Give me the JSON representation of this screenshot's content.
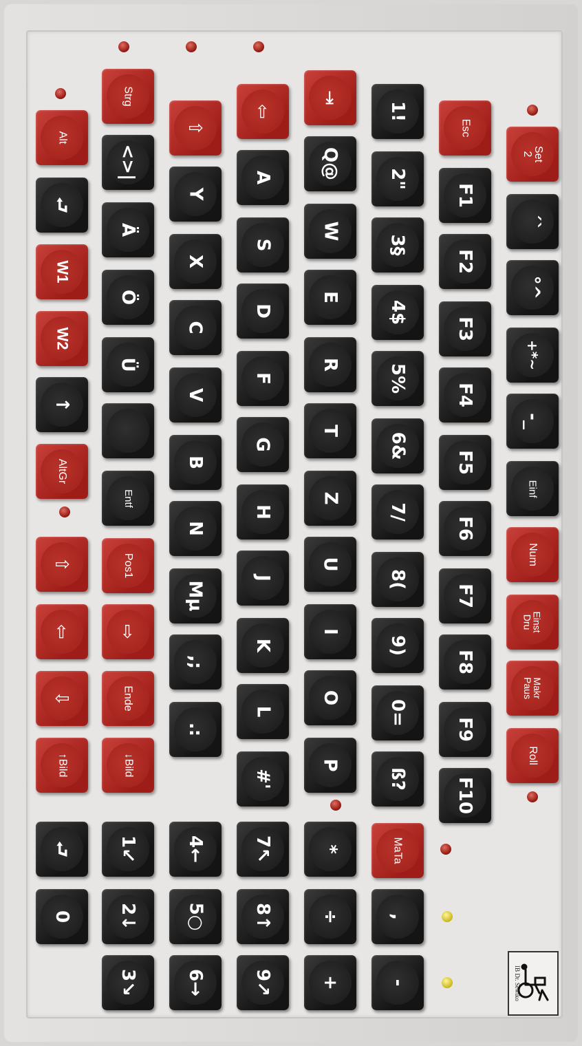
{
  "device": {
    "name": "On-screen keyboard layout (rotated 90°)"
  },
  "brand": {
    "logo_text": "IB Dr. Sewiko",
    "icon": "wheelchair-computer-icon"
  },
  "colors": {
    "dark_key": "#1c1c1c",
    "red_key": "#b02822",
    "panel": "#e8e6e4",
    "led_red": "#8d1810",
    "led_yellow": "#d8c62a"
  },
  "keys": {
    "alt": "Alt",
    "enter_left": "⮐",
    "w1": "W1",
    "w2": "W2",
    "arrow_up": "↑",
    "altgr": "AltGr",
    "shift_up": "⇧",
    "shift_left": "⇦",
    "shift_down": "⇩",
    "bild_up_left": "↑Bild",
    "enter_num": "⮐",
    "num0": "0",
    "strg": "Strg",
    "lt_gt": "<>|",
    "ae": "Ä",
    "oe": "Ö",
    "ue": "Ü",
    "blank": "",
    "entf": "Entf",
    "pos1": "Pos1",
    "arrow_right": "⇨",
    "ende": "Ende",
    "bild_down": "↓Bild",
    "num1": "1↙",
    "num2": "2↓",
    "num3": "3↘",
    "shift_r": "⇧",
    "y": "Y",
    "x": "X",
    "c": "C",
    "v": "V",
    "b": "B",
    "n": "N",
    "m": "Mµ",
    "comma": ",;",
    "period": ".:",
    "num4": "4←",
    "num5": "5○",
    "num6": "6→",
    "shift_l": "⇦",
    "a": "A",
    "s": "S",
    "d": "D",
    "f": "F",
    "g": "G",
    "h": "H",
    "j": "J",
    "k": "K",
    "l": "L",
    "hash": "#'",
    "num7": "7↖",
    "num8": "8↑",
    "num9": "9↗",
    "tab": "⇥",
    "q": "Q@",
    "w": "W",
    "e": "E",
    "r": "R",
    "t": "T",
    "z": "Z",
    "u": "U",
    "i": "I",
    "o": "O",
    "p": "P",
    "multiply": "*",
    "divide": "÷",
    "plus": "+",
    "d1": "1!",
    "d2": "2\"",
    "d3": "3§",
    "d4": "4$",
    "d5": "5%",
    "d6": "6&",
    "d7": "7/",
    "d8": "8(",
    "d9": "9)",
    "d0": "0=",
    "sz": "ß?",
    "mata": "MaTa",
    "num_comma": ",",
    "minus": "-",
    "esc": "Esc",
    "f1": "F1",
    "f2": "F2",
    "f3": "F3",
    "f4": "F4",
    "f5": "F5",
    "f6": "F6",
    "f7": "F7",
    "f8": "F8",
    "f9": "F9",
    "f10": "F10",
    "set2": "Set\n2",
    "acute": "´`",
    "ring": "°^",
    "plus_star": "+*~",
    "dash": "-_",
    "einf": "Einf",
    "num_lock": "Num",
    "einst_dru": "Einst\nDru",
    "makr_paus": "Makr\nPaus",
    "roll": "Roll"
  }
}
